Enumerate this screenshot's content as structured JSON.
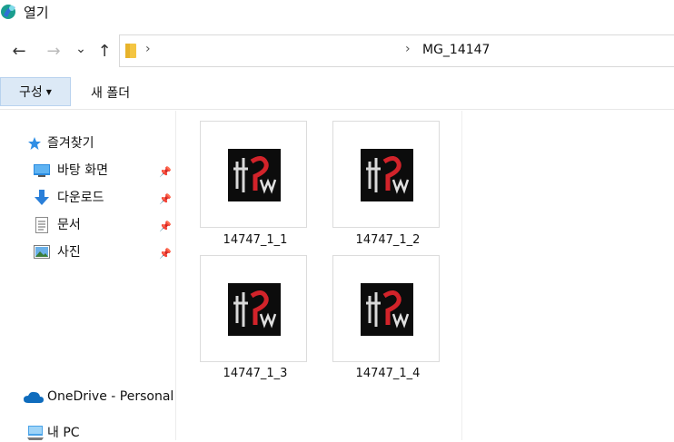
{
  "window": {
    "title": "열기"
  },
  "nav": {
    "back_glyph": "←",
    "forward_glyph": "→",
    "recent_glyph": "⌄",
    "up_glyph": "↑"
  },
  "address": {
    "chevron": "›",
    "current_folder": "MG_14147"
  },
  "toolbar": {
    "organize_label": "구성",
    "organize_arrow": "▼",
    "new_folder_label": "새 폴더"
  },
  "sidebar": {
    "quick_access": "즐겨찾기",
    "items": [
      {
        "label": "바탕 화면",
        "icon": "desktop-icon",
        "pinned": true
      },
      {
        "label": "다운로드",
        "icon": "download-icon",
        "pinned": true
      },
      {
        "label": "문서",
        "icon": "document-icon",
        "pinned": true
      },
      {
        "label": "사진",
        "icon": "pictures-icon",
        "pinned": true
      }
    ],
    "pin_glyph": "📌",
    "onedrive": "OneDrive - Personal",
    "this_pc": "내 PC"
  },
  "files": [
    {
      "name": "14747_1_1"
    },
    {
      "name": "14747_1_2"
    },
    {
      "name": "14747_1_3"
    },
    {
      "name": "14747_1_4"
    }
  ],
  "colors": {
    "accent": "#0078d4",
    "toolbar_button_bg": "#dce9f6",
    "thumb_bg": "#0c0c0c",
    "thumb_red": "#d2232a"
  }
}
